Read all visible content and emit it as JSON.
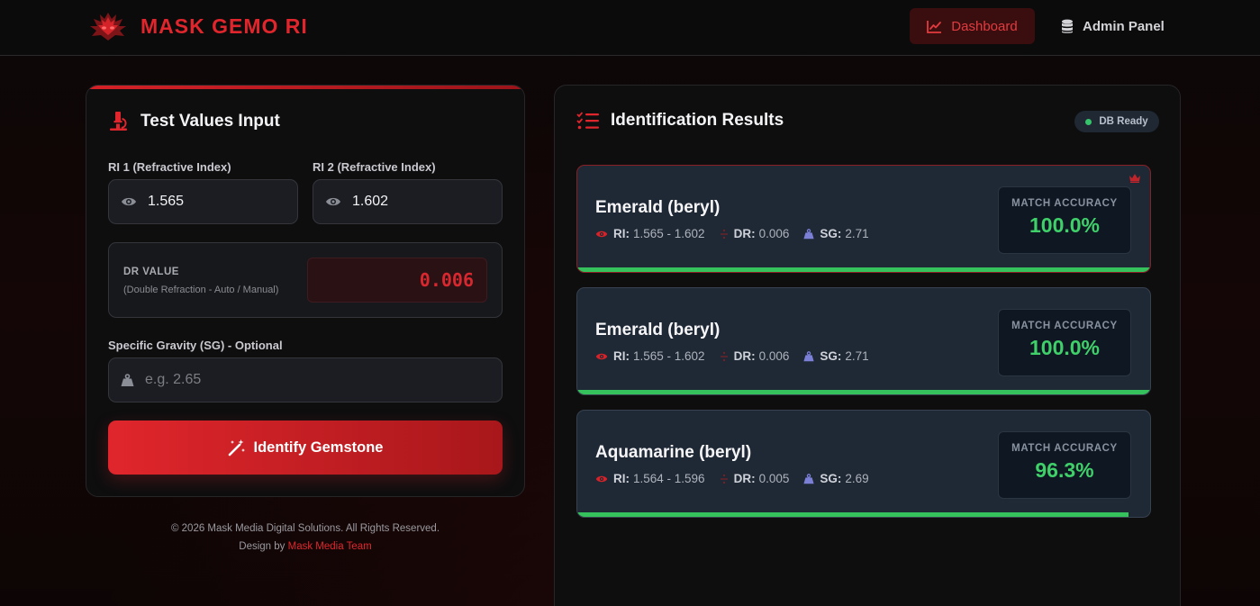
{
  "header": {
    "brand": "MASK GEMO RI",
    "nav": {
      "dashboard": "Dashboard",
      "admin": "Admin Panel"
    }
  },
  "input_panel": {
    "title": "Test Values Input",
    "ri1": {
      "label": "RI 1 (Refractive Index)",
      "value": "1.565"
    },
    "ri2": {
      "label": "RI 2 (Refractive Index)",
      "value": "1.602"
    },
    "dr": {
      "title": "DR VALUE",
      "subtitle": "(Double Refraction - Auto / Manual)",
      "value": "0.006"
    },
    "sg": {
      "label": "Specific Gravity (SG) - Optional",
      "placeholder": "e.g. 2.65"
    },
    "button": "Identify Gemstone"
  },
  "footer": {
    "copyright": "© 2026 Mask Media Digital Solutions. All Rights Reserved.",
    "design_prefix": "Design by ",
    "design_team": "Mask Media Team"
  },
  "results_panel": {
    "title": "Identification Results",
    "badge": "DB Ready",
    "accuracy_label": "MATCH ACCURACY",
    "labels": {
      "ri": "RI:",
      "dr": "DR:",
      "sg": "SG:"
    },
    "items": [
      {
        "name": "Emerald (beryl)",
        "ri": "1.565 - 1.602",
        "dr": "0.006",
        "sg": "2.71",
        "accuracy": "100.0%",
        "accuracy_fraction": 1.0
      },
      {
        "name": "Emerald (beryl)",
        "ri": "1.565 - 1.602",
        "dr": "0.006",
        "sg": "2.71",
        "accuracy": "100.0%",
        "accuracy_fraction": 1.0
      },
      {
        "name": "Aquamarine (beryl)",
        "ri": "1.564 - 1.596",
        "dr": "0.005",
        "sg": "2.69",
        "accuracy": "96.3%",
        "accuracy_fraction": 0.963
      }
    ]
  },
  "colors": {
    "accent": "#e0262c",
    "success": "#3fd06a",
    "card": "#1f2835"
  }
}
